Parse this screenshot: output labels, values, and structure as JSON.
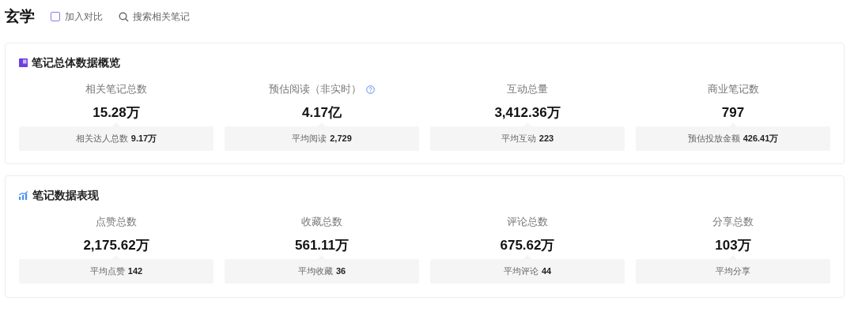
{
  "page_title": "玄学",
  "compare": {
    "label": "加入对比",
    "checked": false
  },
  "search_link": {
    "label": "搜索相关笔记"
  },
  "sections": [
    {
      "title": "笔记总体数据概览",
      "kind": "overview",
      "stats": [
        {
          "label": "相关笔记总数",
          "value": "15.28万",
          "sub_label": "相关达人总数",
          "sub_value": "9.17万"
        },
        {
          "label": "预估阅读（非实时）",
          "value": "4.17亿",
          "sub_label": "平均阅读",
          "sub_value": "2,729",
          "help": true
        },
        {
          "label": "互动总量",
          "value": "3,412.36万",
          "sub_label": "平均互动",
          "sub_value": "223"
        },
        {
          "label": "商业笔记数",
          "value": "797",
          "sub_label": "预估投放金额",
          "sub_value": "426.41万"
        }
      ]
    },
    {
      "title": "笔记数据表现",
      "kind": "performance",
      "stats": [
        {
          "label": "点赞总数",
          "value": "2,175.62万",
          "sub_label": "平均点赞",
          "sub_value": "142"
        },
        {
          "label": "收藏总数",
          "value": "561.11万",
          "sub_label": "平均收藏",
          "sub_value": "36"
        },
        {
          "label": "评论总数",
          "value": "675.62万",
          "sub_label": "平均评论",
          "sub_value": "44"
        },
        {
          "label": "分享总数",
          "value": "103万",
          "sub_label": "平均分享"
        }
      ]
    }
  ]
}
